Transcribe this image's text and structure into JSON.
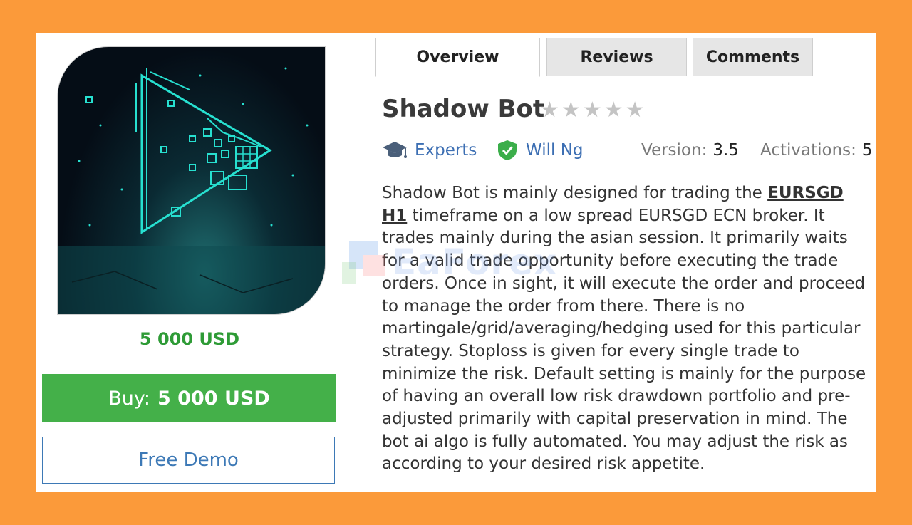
{
  "tabs": [
    {
      "label": "Overview",
      "active": true
    },
    {
      "label": "Reviews",
      "active": false
    },
    {
      "label": "Comments",
      "active": false
    }
  ],
  "product": {
    "title": "Shadow Bot",
    "rating_stars": 0,
    "rating_max": 5,
    "price": "5 000 USD",
    "category": "Experts",
    "author": "Will Ng",
    "version_label": "Version:",
    "version": "3.5",
    "activations_label": "Activations:",
    "activations": "5"
  },
  "buttons": {
    "buy_prefix": "Buy:",
    "buy_price": "5 000 USD",
    "demo": "Free Demo"
  },
  "description": {
    "p1": "Shadow Bot is mainly designed for trading the ",
    "link": "EURSGD H1",
    "p2": " timeframe on a low spread EURSGD ECN broker. It trades mainly during the asian session. It primarily waits for a valid trade opportunity before executing the trade orders. Once in sight, it will execute the order and proceed to manage the order from there. There is no martingale/grid/averaging/hedging used for this particular strategy. Stoploss is given for every single trade to minimize the risk. Default setting is mainly for the purpose of having an overall low risk drawdown portfolio and pre-adjusted primarily with capital preservation in mind. The bot ai algo is fully automated. You may adjust the risk as according to your desired risk appetite."
  },
  "watermark": "EaForex",
  "colors": {
    "background": "#fb9a3a",
    "buy_button": "#44b049",
    "price": "#2e9b36",
    "link": "#3d6fb3",
    "star_empty": "#c4c4c4",
    "neon": "#27e0d0"
  },
  "icons": {
    "category": "graduation-cap-icon",
    "author": "verified-shield-icon",
    "star": "star-icon"
  }
}
